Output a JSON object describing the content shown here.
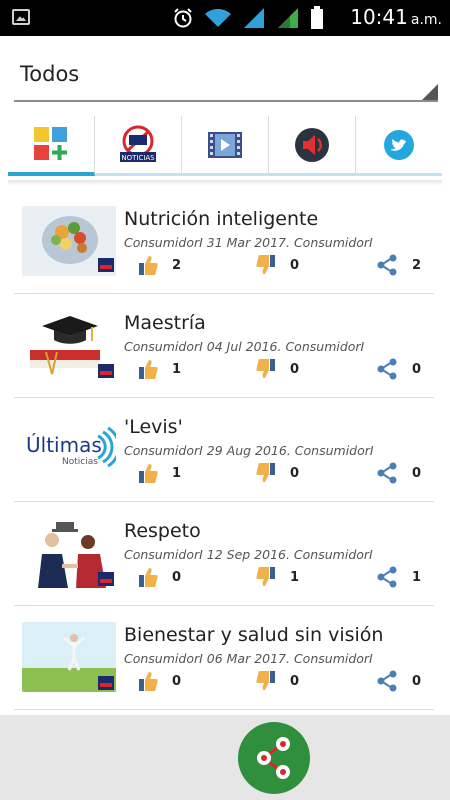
{
  "status_bar": {
    "time": "10:41",
    "ampm": "a.m."
  },
  "filter": {
    "selected": "Todos"
  },
  "tabs": [
    {
      "name": "all",
      "icon": "apps-grid-plus-icon"
    },
    {
      "name": "news",
      "icon": "noticias-icon"
    },
    {
      "name": "video",
      "icon": "video-film-icon"
    },
    {
      "name": "audio",
      "icon": "speaker-icon"
    },
    {
      "name": "twitter",
      "icon": "twitter-icon"
    }
  ],
  "items": [
    {
      "title": "Nutrición inteligente",
      "meta": "ConsumidorI  31 Mar 2017.  ConsumidorI",
      "likes": "2",
      "dislikes": "0",
      "shares": "2"
    },
    {
      "title": "Maestría",
      "meta": "ConsumidorI  04 Jul 2016.  ConsumidorI",
      "likes": "1",
      "dislikes": "0",
      "shares": "0"
    },
    {
      "title": "'Levis'",
      "meta": "ConsumidorI  29 Aug 2016.  ConsumidorI",
      "likes": "1",
      "dislikes": "0",
      "shares": "0"
    },
    {
      "title": "Respeto",
      "meta": "ConsumidorI  12 Sep 2016.  ConsumidorI",
      "likes": "0",
      "dislikes": "1",
      "shares": "1"
    },
    {
      "title": "Bienestar y salud sin visión",
      "meta": "ConsumidorI  06 Mar 2017.  ConsumidorI",
      "likes": "0",
      "dislikes": "0",
      "shares": "0"
    }
  ],
  "thumbs": {
    "levis_text_1": "Últimas",
    "levis_text_2": "Noticias",
    "news_badge": "NOTICIAS"
  },
  "colors": {
    "accent": "#27a6d6",
    "fab": "#2f8f3d",
    "action_icon": "#4a7fb5",
    "thumb_icon": "#f0b14a"
  }
}
